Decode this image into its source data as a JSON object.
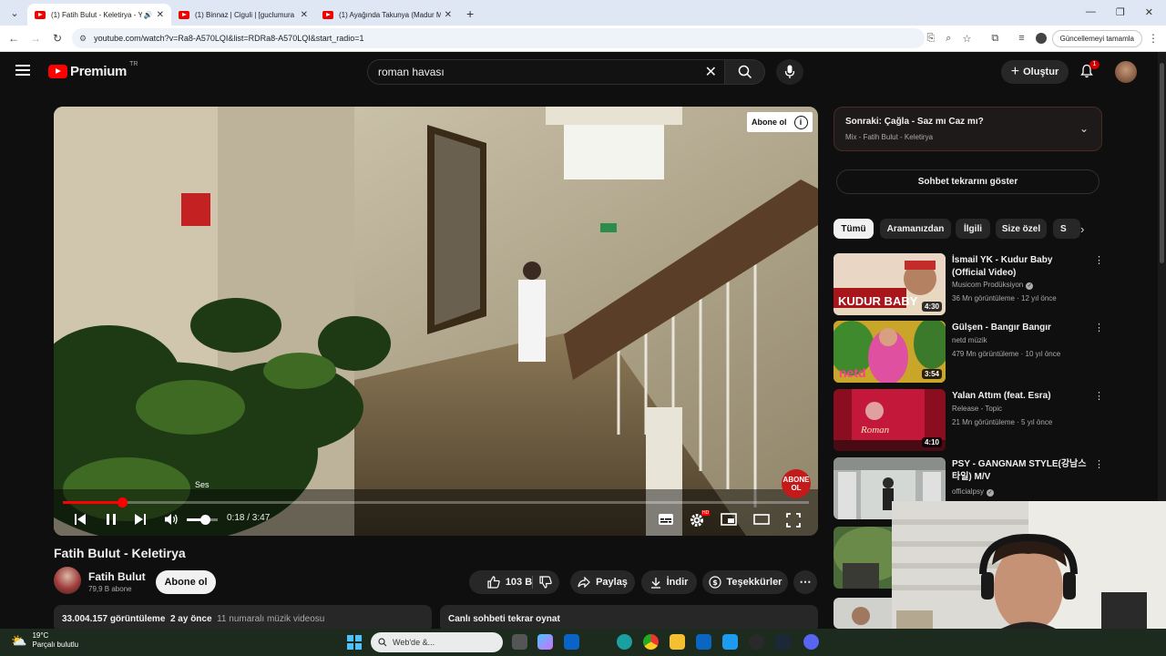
{
  "browser": {
    "tabs": [
      {
        "title": "(1) Fatih Bulut - Keletirya - Y",
        "active": true,
        "audio": true
      },
      {
        "title": "(1) Binnaz | Ciguli | [guclumura",
        "active": false
      },
      {
        "title": "(1) Ayağında Takunya (Madur M",
        "active": false
      }
    ],
    "url": "youtube.com/watch?v=Ra8-A570LQI&list=RDRa8-A570LQI&start_radio=1",
    "update_button": "Güncellemeyi tamamla"
  },
  "yt_header": {
    "logo_text": "Premium",
    "country": "TR",
    "search_value": "roman havası",
    "create_label": "Oluştur",
    "notification_count": "1"
  },
  "player": {
    "subscribe_overlay": "Abone ol",
    "stamp_line1": "ABONE",
    "stamp_line2": "OL",
    "tooltip": "Ses",
    "time": "0:18 / 3:47",
    "progress_fraction": 0.079,
    "volume_fraction": 0.6,
    "settings_badge": "HD"
  },
  "video": {
    "title": "Fatih Bulut - Keletirya",
    "channel": "Fatih Bulut",
    "subscribers": "79,9 B abone",
    "subscribe_label": "Abone ol",
    "likes": "103 B",
    "share_label": "Paylaş",
    "download_label": "İndir",
    "thanks_label": "Teşekkürler",
    "views": "33.004.157 görüntüleme",
    "age": "2 ay önce",
    "extra": "11 numaralı müzik videosu",
    "chat_replay": "Canlı sohbeti tekrar oynat"
  },
  "sidebar": {
    "next_title": "Sonraki: Çağla - Saz mı Caz mı?",
    "next_sub": "Mix - Fatih Bulut - Keletirya",
    "chat_button": "Sohbet tekrarını göster",
    "chips": [
      "Tümü",
      "Aramanızdan",
      "İlgili",
      "Size özel",
      "S"
    ],
    "recs": [
      {
        "title": "İsmail YK - Kudur Baby (Official Video)",
        "channel": "Musicom Prodüksiyon",
        "verified": true,
        "meta": "36 Mn görüntüleme · 12 yıl önce",
        "duration": "4:30",
        "thumb_text": "KUDUR BABY"
      },
      {
        "title": "Gülşen - Bangır Bangır",
        "channel": "netd müzik",
        "verified": false,
        "meta": "479 Mn görüntüleme · 10 yıl önce",
        "duration": "3:54",
        "thumb_text": "netd"
      },
      {
        "title": "Yalan Attım (feat. Esra)",
        "channel": "Release - Topic",
        "verified": false,
        "meta": "21 Mn görüntüleme · 5 yıl önce",
        "duration": "4:10",
        "thumb_text": "Roman"
      },
      {
        "title": "PSY - GANGNAM STYLE(강남스타일) M/V",
        "channel": "officialpsy",
        "verified": true,
        "meta": "",
        "duration": "",
        "thumb_text": ""
      }
    ]
  },
  "taskbar": {
    "temperature": "19°C",
    "weather": "Parçalı bulutlu",
    "search_placeholder": "Web'de &..."
  },
  "colors": {
    "yt_red": "#ff0000",
    "background": "#0f0f0f",
    "chip_bg": "#272727"
  }
}
